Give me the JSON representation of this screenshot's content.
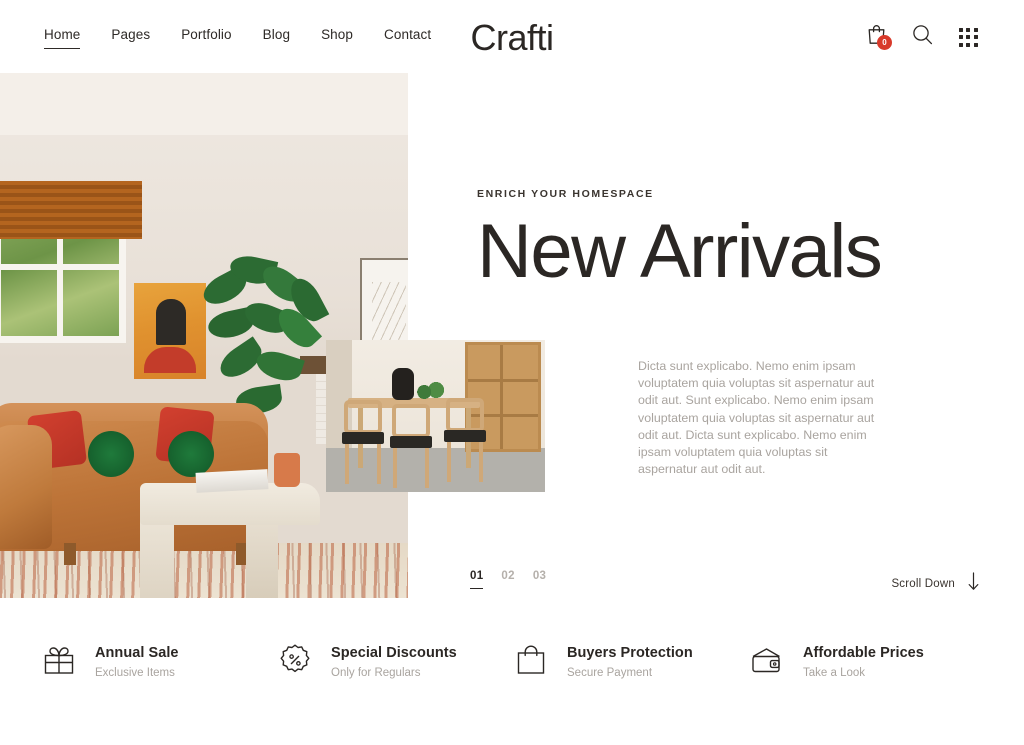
{
  "header": {
    "logo": "Crafti",
    "nav": [
      {
        "label": "Home",
        "active": true
      },
      {
        "label": "Pages",
        "active": false
      },
      {
        "label": "Portfolio",
        "active": false
      },
      {
        "label": "Blog",
        "active": false
      },
      {
        "label": "Shop",
        "active": false
      },
      {
        "label": "Contact",
        "active": false
      }
    ],
    "cart": {
      "icon": "shopping-bag-icon",
      "badge_count": "0",
      "badge_color": "#d83a2b"
    },
    "search": {
      "icon": "search-icon"
    },
    "menu": {
      "icon": "grid-menu-icon"
    }
  },
  "hero": {
    "eyebrow": "ENRICH YOUR HOMESPACE",
    "title": "New Arrivals",
    "description": "Dicta sunt explicabo. Nemo enim ipsam voluptatem quia voluptas sit aspernatur aut odit aut. Sunt explicabo. Nemo enim ipsam voluptatem quia voluptas sit aspernatur aut odit aut. Dicta sunt explicabo. Nemo enim ipsam voluptatem quia voluptas sit aspernatur aut odit aut.",
    "main_image_alt": "Living room with tan leather sofa, red and green cushions, plants and cream coffee table on patterned rug",
    "inset_image_alt": "Dining area with wooden table, chairs, black vase and wooden shelving unit",
    "slides": [
      {
        "label": "01",
        "active": true
      },
      {
        "label": "02",
        "active": false
      },
      {
        "label": "03",
        "active": false
      }
    ],
    "scroll_down": {
      "label": "Scroll Down",
      "icon": "arrow-down-icon"
    }
  },
  "features": [
    {
      "icon": "gift-icon",
      "title": "Annual Sale",
      "subtitle": "Exclusive Items"
    },
    {
      "icon": "percent-badge-icon",
      "title": "Special Discounts",
      "subtitle": "Only for Regulars"
    },
    {
      "icon": "shopping-bag-icon",
      "title": "Buyers Protection",
      "subtitle": "Secure Payment"
    },
    {
      "icon": "wallet-icon",
      "title": "Affordable Prices",
      "subtitle": "Take a Look"
    }
  ],
  "colors": {
    "text_dark": "#2b2724",
    "text_muted": "#a9a49f",
    "badge_red": "#d83a2b",
    "background": "#ffffff"
  }
}
